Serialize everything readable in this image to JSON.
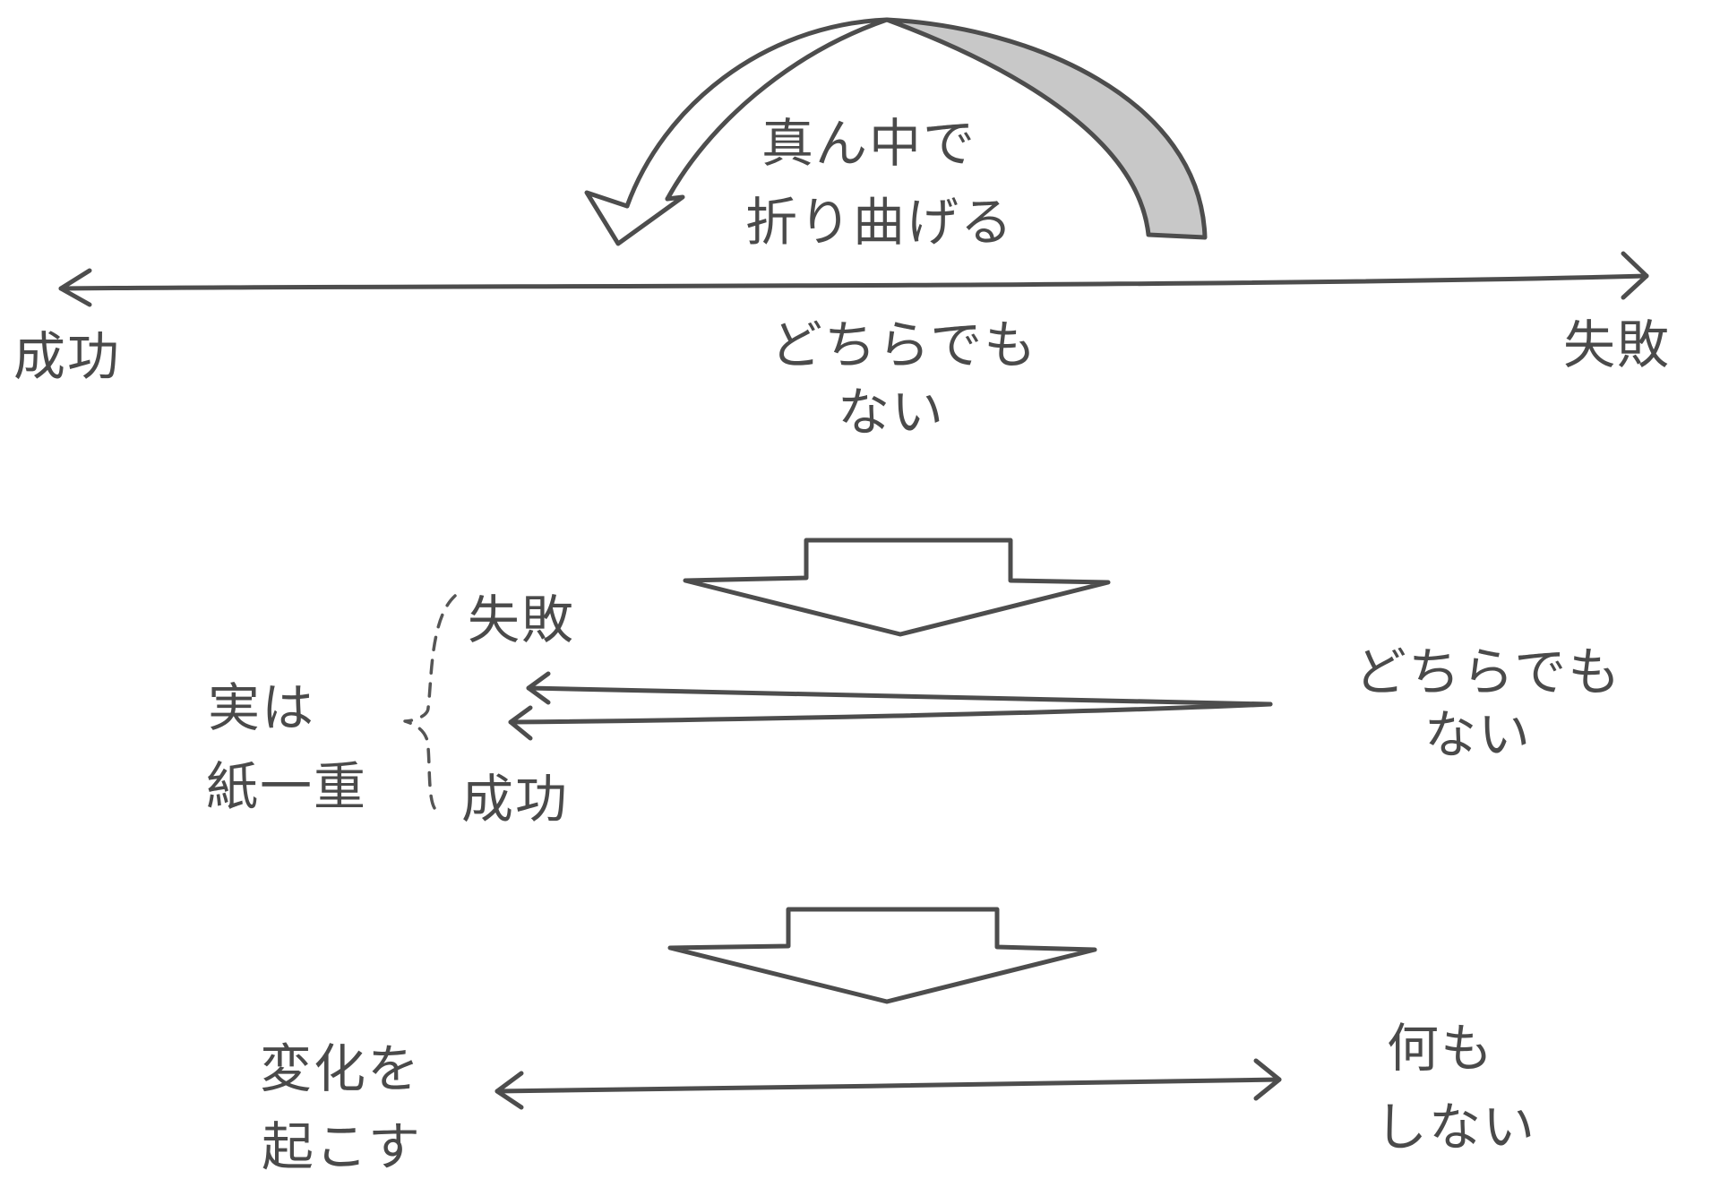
{
  "top": {
    "fold_label": [
      "真ん中で",
      "折り曲げる"
    ],
    "left": "成功",
    "center": [
      "どちらでも",
      "ない"
    ],
    "right": "失敗"
  },
  "middle": {
    "upper": "失敗",
    "lower": "成功",
    "note": [
      "実は",
      "紙一重"
    ],
    "right": [
      "どちらでも",
      "ない"
    ]
  },
  "bottom": {
    "left": [
      "変化を",
      "起こす"
    ],
    "right": [
      "何も",
      "しない"
    ]
  },
  "colors": {
    "ink": "#4d4d4d",
    "fold_fill": "#c8c8c8"
  }
}
